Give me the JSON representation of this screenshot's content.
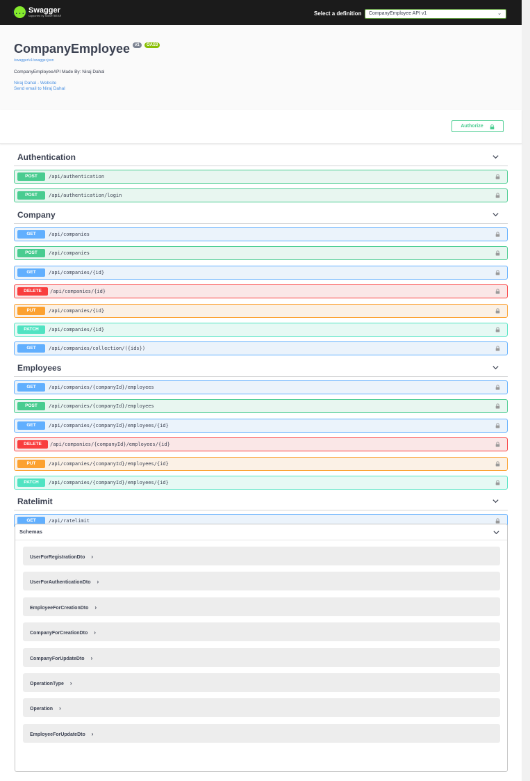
{
  "topbar": {
    "logo_symbol": "{...}",
    "logo_name": "Swagger",
    "logo_sub": "supported by SMARTBEAR",
    "definition_label": "Select a definition",
    "definition_value": "CompanyEmployee API v1"
  },
  "info": {
    "title": "CompanyEmployee",
    "version": "v1",
    "oas": "OAS3",
    "spec_url": "/swagger/v1/swagger.json",
    "description": "CompanyEmployeeAPI Made By: Niraj Dahal",
    "contact_website": "Niraj Dahal - Website",
    "contact_email": "Send email to Niraj Dahal"
  },
  "auth": {
    "authorize_label": "Authorize"
  },
  "tags": [
    {
      "name": "Authentication",
      "operations": [
        {
          "method": "POST",
          "path": "/api/authentication"
        },
        {
          "method": "POST",
          "path": "/api/authentication/login"
        }
      ]
    },
    {
      "name": "Company",
      "operations": [
        {
          "method": "GET",
          "path": "/api/companies"
        },
        {
          "method": "POST",
          "path": "/api/companies"
        },
        {
          "method": "GET",
          "path": "/api/companies/{id}"
        },
        {
          "method": "DELETE",
          "path": "/api/companies/{id}"
        },
        {
          "method": "PUT",
          "path": "/api/companies/{id}"
        },
        {
          "method": "PATCH",
          "path": "/api/companies/{id}"
        },
        {
          "method": "GET",
          "path": "/api/companies/collection/({ids})"
        }
      ]
    },
    {
      "name": "Employees",
      "operations": [
        {
          "method": "GET",
          "path": "/api/companies/{companyId}/employees"
        },
        {
          "method": "POST",
          "path": "/api/companies/{companyId}/employees"
        },
        {
          "method": "GET",
          "path": "/api/companies/{companyId}/employees/{id}"
        },
        {
          "method": "DELETE",
          "path": "/api/companies/{companyId}/employees/{id}"
        },
        {
          "method": "PUT",
          "path": "/api/companies/{companyId}/employees/{id}"
        },
        {
          "method": "PATCH",
          "path": "/api/companies/{companyId}/employees/{id}"
        }
      ]
    },
    {
      "name": "Ratelimit",
      "operations": [
        {
          "method": "GET",
          "path": "/api/ratelimit"
        }
      ]
    }
  ],
  "schemas": {
    "title": "Schemas",
    "models": [
      "UserForRegistrationDto",
      "UserForAuthenticationDto",
      "EmployeeForCreationDto",
      "CompanyForCreationDto",
      "CompanyForUpdateDto",
      "OperationType",
      "Operation",
      "EmployeeForUpdateDto"
    ]
  },
  "colors": {
    "get": "#61affe",
    "post": "#49cc90",
    "delete": "#f93e3e",
    "put": "#fca130",
    "patch": "#50e3c2",
    "brand": "#85ea2d"
  },
  "icons": {
    "lock": "lock-icon",
    "chevron_down": "chevron-down-icon",
    "chevron_right": "chevron-right-icon"
  }
}
